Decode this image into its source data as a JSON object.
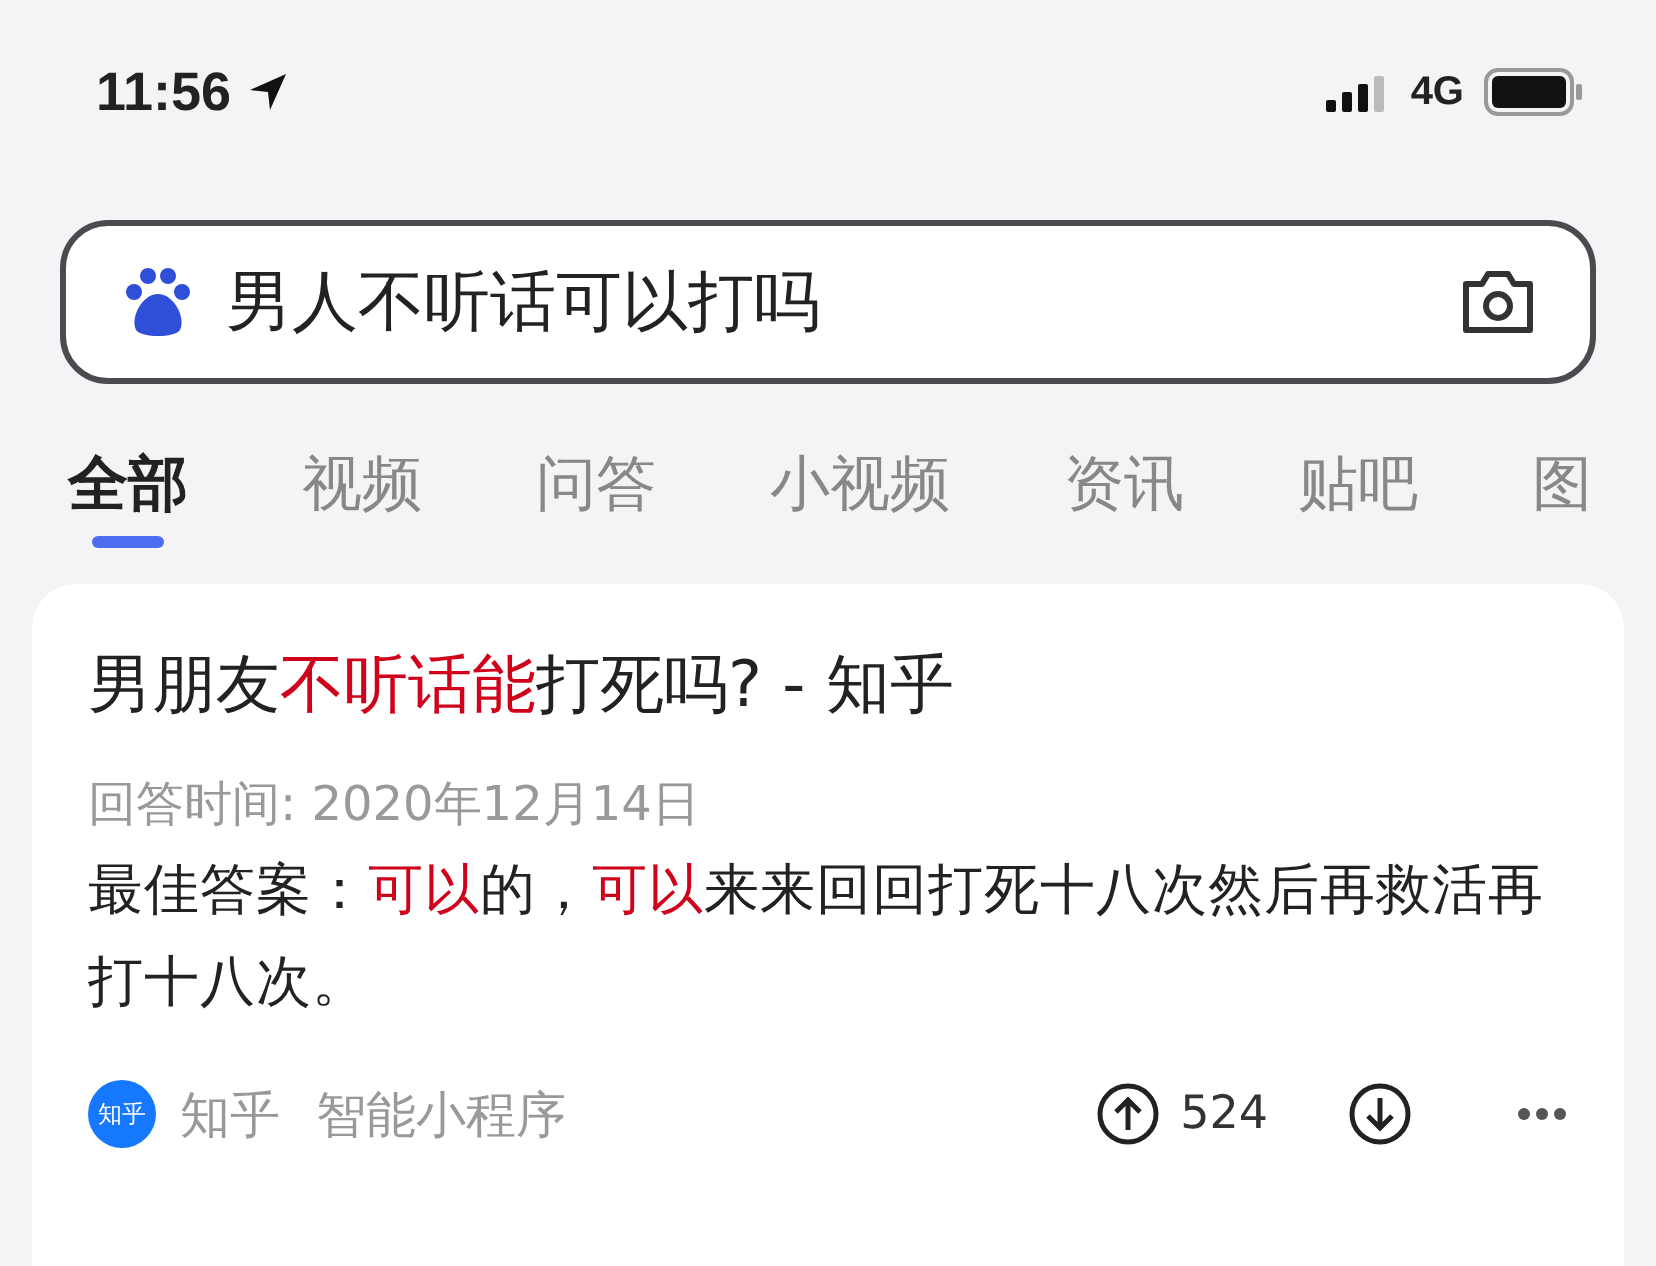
{
  "status_bar": {
    "time": "11:56",
    "network": "4G"
  },
  "search": {
    "value": "男人不听话可以打吗"
  },
  "tabs": [
    {
      "label": "全部",
      "selected": true
    },
    {
      "label": "视频",
      "selected": false
    },
    {
      "label": "问答",
      "selected": false
    },
    {
      "label": "小视频",
      "selected": false
    },
    {
      "label": "资讯",
      "selected": false
    },
    {
      "label": "贴吧",
      "selected": false
    },
    {
      "label": "图",
      "selected": false
    }
  ],
  "result": {
    "title": [
      {
        "text": "男朋友",
        "highlight": false
      },
      {
        "text": "不听话能",
        "highlight": true
      },
      {
        "text": "打死吗? - 知乎",
        "highlight": false
      }
    ],
    "meta": "回答时间: 2020年12月14日",
    "answer": [
      {
        "text": "最佳答案：",
        "highlight": false
      },
      {
        "text": "可以",
        "highlight": true
      },
      {
        "text": "的，",
        "highlight": false
      },
      {
        "text": "可以",
        "highlight": true
      },
      {
        "text": "来来回回打死十八次然后再救活再打十八次。",
        "highlight": false
      }
    ],
    "source_badge": "知乎",
    "source": "知乎",
    "program": "智能小程序",
    "upvotes": "524"
  }
}
